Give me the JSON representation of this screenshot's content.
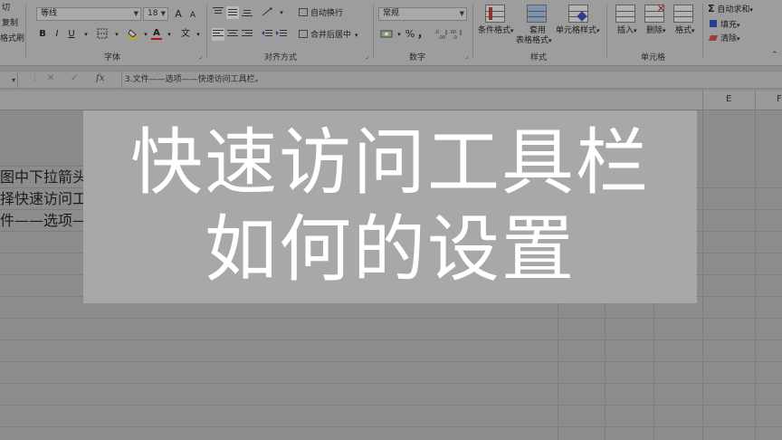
{
  "ribbon": {
    "clipboard": {
      "cut": "切",
      "copy": "复制",
      "format_painter": "格式刷"
    },
    "font": {
      "name": "等线",
      "size": "18",
      "grow": "A",
      "shrink": "A",
      "bold": "B",
      "italic": "I",
      "underline": "U",
      "font_color_letter": "A",
      "phonetic": "文",
      "group_label": "字体"
    },
    "alignment": {
      "wrap_text": "自动换行",
      "merge_center": "合并后居中",
      "group_label": "对齐方式"
    },
    "number": {
      "format": "常规",
      "percent": "%",
      "comma": "，",
      "group_label": "数字"
    },
    "styles": {
      "conditional": "条件格式",
      "table_line1": "套用",
      "table_line2": "表格格式",
      "cell_styles": "单元格样式",
      "group_label": "样式"
    },
    "cells": {
      "insert": "插入",
      "delete": "删除",
      "format": "格式",
      "group_label": "单元格"
    },
    "editing": {
      "autosum": "自动求和",
      "fill": "填充",
      "clear": "清除",
      "sigma": "Σ"
    }
  },
  "formula_bar": {
    "cancel": "✕",
    "enter": "✓",
    "fx": "fx",
    "content": "3.文件——选项——快速访问工具栏。"
  },
  "sheet": {
    "columns": [
      "E",
      "F"
    ],
    "rows": [
      "图中下拉箭头",
      "择快速访问工",
      "件——选项—"
    ]
  },
  "overlay": {
    "line1": "快速访问工具栏",
    "line2": "如何的设置"
  },
  "colors": {
    "overlay_bg": "#a8a8a8",
    "overlay_text": "#ffffff",
    "dimmed_ui": "#8f8f8f"
  }
}
